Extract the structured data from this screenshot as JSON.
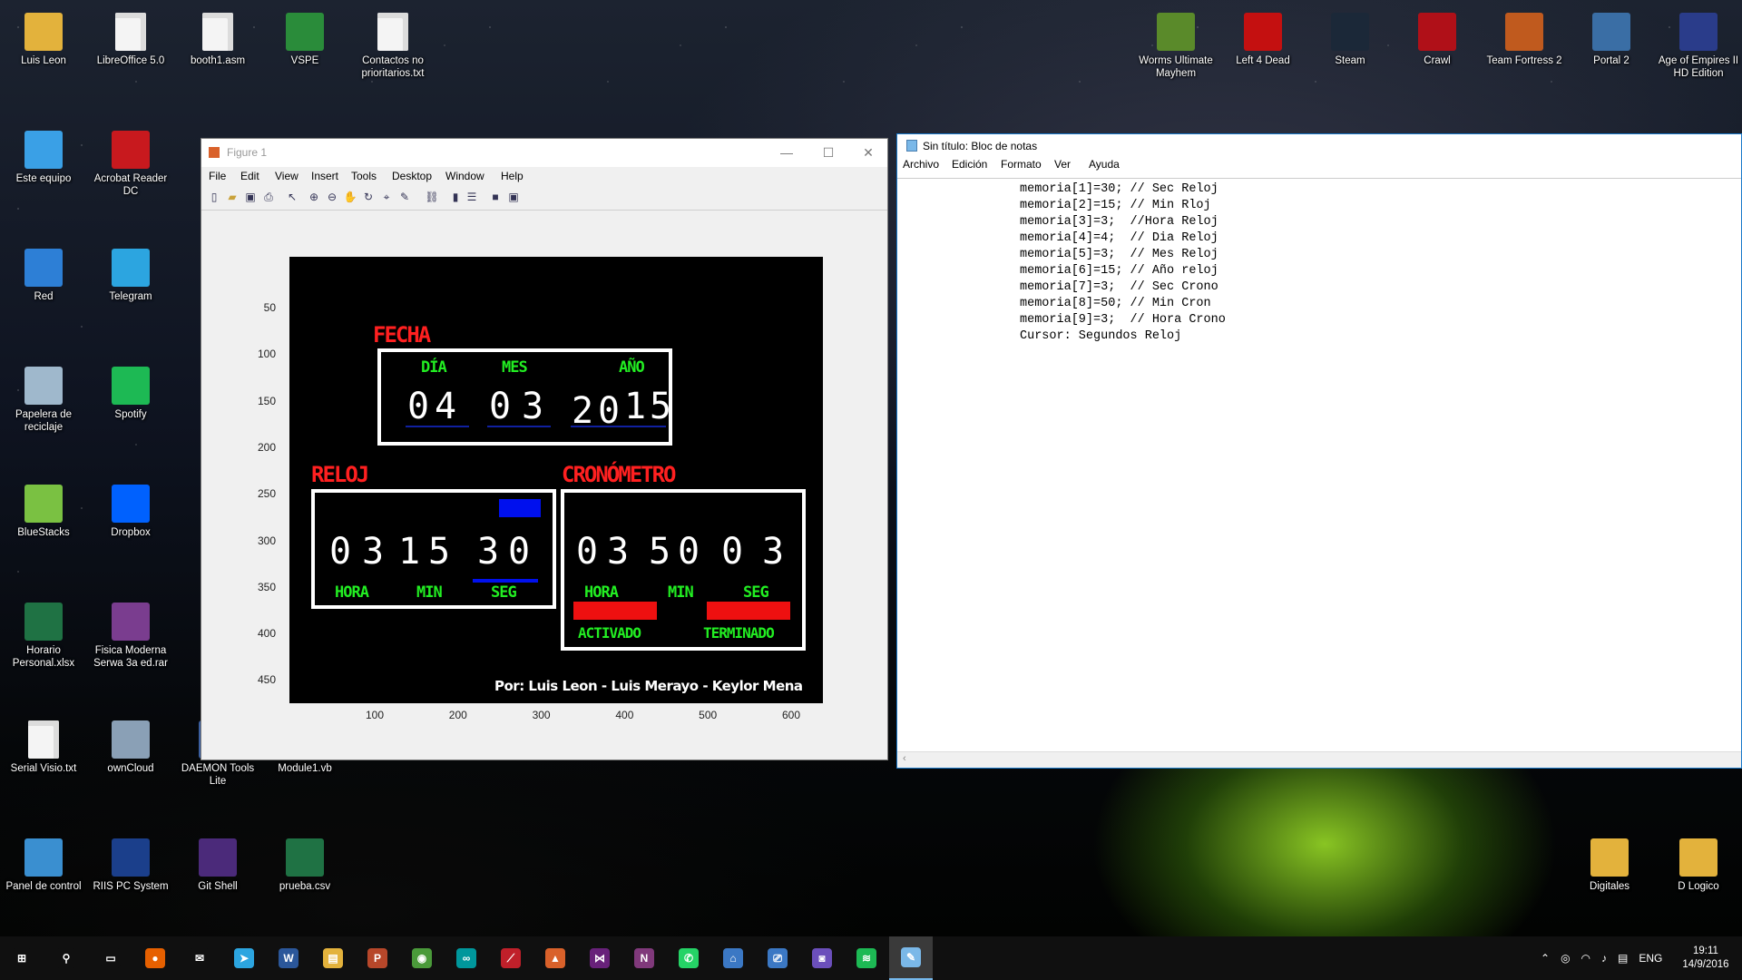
{
  "desktop_icons": [
    {
      "label": "Luis Leon",
      "icon": "user-folder-icon",
      "color": "#e3b23c"
    },
    {
      "label": "LibreOffice 5.0",
      "icon": "libreoffice-icon",
      "color": "#f4f4f4"
    },
    {
      "label": "booth1.asm",
      "icon": "file-icon",
      "color": "#f4f4f4"
    },
    {
      "label": "VSPE",
      "icon": "vspe-icon",
      "color": "#2a8c3a"
    },
    {
      "label": "Contactos no prioritarios.txt",
      "icon": "text-file-icon",
      "color": "#f4f4f4"
    },
    {
      "label": "Este equipo",
      "icon": "computer-icon",
      "color": "#3aa0e6"
    },
    {
      "label": "Acrobat Reader DC",
      "icon": "acrobat-icon",
      "color": "#c8191e"
    },
    {
      "label": "Red",
      "icon": "network-icon",
      "color": "#2d7fd6"
    },
    {
      "label": "Telegram",
      "icon": "telegram-icon",
      "color": "#2ca5e0"
    },
    {
      "label": "Papelera de reciclaje",
      "icon": "recycle-bin-icon",
      "color": "#9fb8cc"
    },
    {
      "label": "Spotify",
      "icon": "spotify-icon",
      "color": "#1db954"
    },
    {
      "label": "BlueStacks",
      "icon": "bluestacks-icon",
      "color": "#7ac142"
    },
    {
      "label": "Dropbox",
      "icon": "dropbox-icon",
      "color": "#0061fe"
    },
    {
      "label": "Horario Personal.xlsx",
      "icon": "excel-icon",
      "color": "#1f7244"
    },
    {
      "label": "Fisica Moderna Serwa 3a ed.rar",
      "icon": "winrar-icon",
      "color": "#7a3d8f"
    },
    {
      "label": "Serial Visio.txt",
      "icon": "text-file-icon",
      "color": "#f4f4f4"
    },
    {
      "label": "ownCloud",
      "icon": "owncloud-icon",
      "color": "#8aa0b6"
    },
    {
      "label": "DAEMON Tools Lite",
      "icon": "daemon-tools-icon",
      "color": "#3b5fa0"
    },
    {
      "label": "Module1.vb",
      "icon": "file-icon",
      "color": "#f4f4f4"
    },
    {
      "label": "Panel de control",
      "icon": "control-panel-icon",
      "color": "#3a8fd0"
    },
    {
      "label": "RIIS PC System",
      "icon": "accessibility-icon",
      "color": "#1b3f8b"
    },
    {
      "label": "Git Shell",
      "icon": "git-shell-icon",
      "color": "#4b2a7a"
    },
    {
      "label": "prueba.csv",
      "icon": "excel-csv-icon",
      "color": "#1f7244"
    },
    {
      "label": "Worms Ultimate Mayhem",
      "icon": "worms-icon",
      "color": "#5a8a2a"
    },
    {
      "label": "Left 4 Dead",
      "icon": "left4dead-icon",
      "color": "#c41010"
    },
    {
      "label": "Steam",
      "icon": "steam-icon",
      "color": "#1b2838"
    },
    {
      "label": "Crawl",
      "icon": "crawl-icon",
      "color": "#b01018"
    },
    {
      "label": "Team Fortress 2",
      "icon": "tf2-icon",
      "color": "#c05a1e"
    },
    {
      "label": "Portal 2",
      "icon": "portal2-icon",
      "color": "#3a6ea5"
    },
    {
      "label": "Age of Empires II HD Edition",
      "icon": "aoe2-icon",
      "color": "#2a3c8a"
    },
    {
      "label": "Digitales",
      "icon": "folder-icon",
      "color": "#e3b23c"
    },
    {
      "label": "D Logico",
      "icon": "folder-icon",
      "color": "#e3b23c"
    }
  ],
  "figure": {
    "title": "Figure 1",
    "menu": [
      "File",
      "Edit",
      "View",
      "Insert",
      "Tools",
      "Desktop",
      "Window",
      "Help"
    ],
    "yticks": [
      "50",
      "100",
      "150",
      "200",
      "250",
      "300",
      "350",
      "400",
      "450"
    ],
    "xticks": [
      "100",
      "200",
      "300",
      "400",
      "500",
      "600"
    ],
    "display": {
      "fecha_title": "FECHA",
      "dia_label": "DÍA",
      "mes_label": "MES",
      "anio_label": "AÑO",
      "dia_digits": [
        "0",
        "4"
      ],
      "mes_digits": [
        "0",
        "3"
      ],
      "anio_digits": [
        "2",
        "0",
        "1",
        "5"
      ],
      "reloj_title": "RELOJ",
      "reloj_digits": [
        "0",
        "3",
        "1",
        "5",
        "3",
        "0"
      ],
      "hora_label": "HORA",
      "min_label": "MIN",
      "seg_label": "SEG",
      "crono_title": "CRONÓMETRO",
      "crono_digits": [
        "0",
        "3",
        "5",
        "0",
        "0",
        "3"
      ],
      "activado": "ACTIVADO",
      "terminado": "TERMINADO",
      "credits": "Por: Luis Leon - Luis Merayo - Keylor Mena"
    }
  },
  "notepad": {
    "title": "Sin título: Bloc de notas",
    "menu": [
      "Archivo",
      "Edición",
      "Formato",
      "Ver",
      "Ayuda"
    ],
    "lines": [
      "memoria[1]=30; // Sec Reloj",
      "memoria[2]=15; // Min Rloj",
      "memoria[3]=3;  //Hora Reloj",
      "memoria[4]=4;  // Dia Reloj",
      "memoria[5]=3;  // Mes Reloj",
      "memoria[6]=15; // Año reloj",
      "memoria[7]=3;  // Sec Crono",
      "memoria[8]=50; // Min Cron",
      "memoria[9]=3;  // Hora Crono",
      "Cursor: Segundos Reloj"
    ]
  },
  "taskbar": {
    "apps": [
      {
        "name": "start-button",
        "glyph": "⊞",
        "color": "#101010"
      },
      {
        "name": "search-icon",
        "glyph": "⚲",
        "color": "#101010"
      },
      {
        "name": "task-view-icon",
        "glyph": "▭",
        "color": "#101010"
      },
      {
        "name": "firefox-icon",
        "glyph": "●",
        "color": "#e66000"
      },
      {
        "name": "mail-icon",
        "glyph": "✉",
        "color": "#101010"
      },
      {
        "name": "telegram-icon",
        "glyph": "➤",
        "color": "#2ca5e0"
      },
      {
        "name": "word-icon",
        "glyph": "W",
        "color": "#2b579a"
      },
      {
        "name": "file-explorer-icon",
        "glyph": "▤",
        "color": "#e3b23c"
      },
      {
        "name": "presenter-icon",
        "glyph": "P",
        "color": "#b7472a"
      },
      {
        "name": "chrome-icon",
        "glyph": "◉",
        "color": "#4a9a3a"
      },
      {
        "name": "arduino-icon",
        "glyph": "∞",
        "color": "#00979c"
      },
      {
        "name": "logisim-icon",
        "glyph": "⟋",
        "color": "#c0202a"
      },
      {
        "name": "matlab-icon",
        "glyph": "▲",
        "color": "#d9612a"
      },
      {
        "name": "visual-studio-icon",
        "glyph": "⋈",
        "color": "#68217a"
      },
      {
        "name": "onenote-icon",
        "glyph": "N",
        "color": "#80397b"
      },
      {
        "name": "whatsapp-icon",
        "glyph": "✆",
        "color": "#25d366"
      },
      {
        "name": "remote-desktop-icon",
        "glyph": "⌂",
        "color": "#3b78c4"
      },
      {
        "name": "network-tool-icon",
        "glyph": "⎚",
        "color": "#3b78c4"
      },
      {
        "name": "discord-icon",
        "glyph": "◙",
        "color": "#6b4fbb"
      },
      {
        "name": "spotify-icon",
        "glyph": "≋",
        "color": "#1db954"
      },
      {
        "name": "notepad-icon",
        "glyph": "✎",
        "color": "#7ab8e8"
      }
    ],
    "tray": {
      "lang": "ENG",
      "time": "19:11",
      "date": "14/9/2016"
    }
  }
}
